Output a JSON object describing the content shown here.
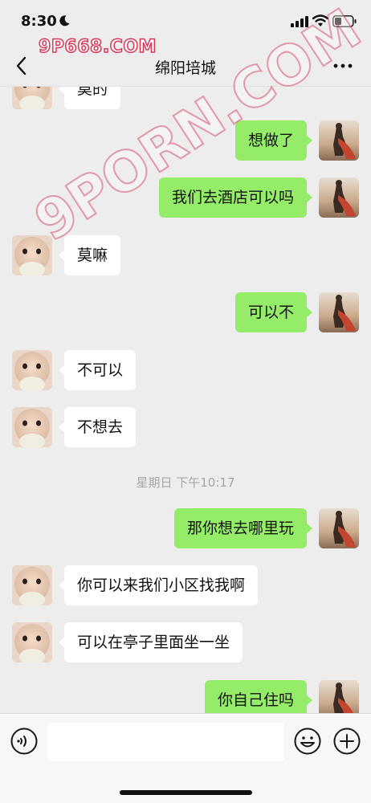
{
  "status_bar": {
    "time": "8:30"
  },
  "watermarks": {
    "top": "9P668.COM",
    "diagonal": "9PORN.COM"
  },
  "header": {
    "title": "绵阳培城"
  },
  "messages": [
    {
      "side": "left",
      "text": "莫的"
    },
    {
      "side": "right",
      "text": "想做了"
    },
    {
      "side": "right",
      "text": "我们去酒店可以吗"
    },
    {
      "side": "left",
      "text": "莫嘛"
    },
    {
      "side": "right",
      "text": "可以不"
    },
    {
      "side": "left",
      "text": "不可以"
    },
    {
      "side": "left",
      "text": "不想去"
    },
    {
      "side": "right",
      "text": "那你想去哪里玩"
    },
    {
      "side": "left",
      "text": "你可以来我们小区找我啊"
    },
    {
      "side": "left",
      "text": "可以在亭子里面坐一坐"
    },
    {
      "side": "right",
      "text": "你自己住吗"
    }
  ],
  "timestamp": "星期日 下午10:17",
  "colors": {
    "sent_bubble": "#95ec69",
    "received_bubble": "#ffffff",
    "background": "#ededed"
  },
  "icons": [
    "moon-icon",
    "signal-icon",
    "wifi-icon",
    "battery-icon",
    "back-icon",
    "more-icon",
    "voice-icon",
    "emoji-icon",
    "plus-icon"
  ]
}
